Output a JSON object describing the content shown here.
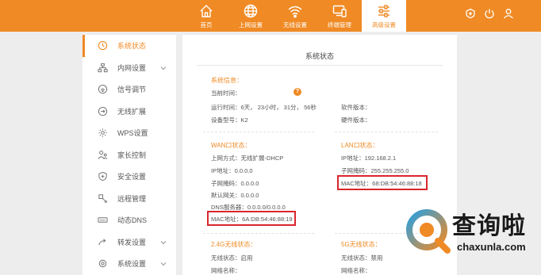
{
  "topnav": {
    "items": [
      {
        "label": "首页",
        "icon": "home-icon",
        "active": false
      },
      {
        "label": "上网设置",
        "icon": "globe-icon",
        "active": false
      },
      {
        "label": "无线设置",
        "icon": "wifi-icon",
        "active": false
      },
      {
        "label": "终端管理",
        "icon": "devices-icon",
        "active": false
      },
      {
        "label": "高级设置",
        "icon": "sliders-icon",
        "active": true
      }
    ],
    "right_icons": [
      "add-circle-icon",
      "power-icon",
      "user-icon"
    ]
  },
  "sidebar": {
    "items": [
      {
        "label": "系统状态",
        "icon": "clock-icon",
        "active": true,
        "expandable": false
      },
      {
        "label": "内网设置",
        "icon": "network-icon",
        "active": false,
        "expandable": true
      },
      {
        "label": "信号调节",
        "icon": "signal-icon",
        "active": false,
        "expandable": false
      },
      {
        "label": "无线扩展",
        "icon": "extend-icon",
        "active": false,
        "expandable": false
      },
      {
        "label": "WPS设置",
        "icon": "gear-icon",
        "active": false,
        "expandable": false
      },
      {
        "label": "家长控制",
        "icon": "parental-icon",
        "active": false,
        "expandable": false
      },
      {
        "label": "安全设置",
        "icon": "shield-icon",
        "active": false,
        "expandable": false
      },
      {
        "label": "远程管理",
        "icon": "remote-icon",
        "active": false,
        "expandable": false
      },
      {
        "label": "动态DNS",
        "icon": "dns-icon",
        "active": false,
        "expandable": false
      },
      {
        "label": "转发设置",
        "icon": "forward-icon",
        "active": false,
        "expandable": true
      },
      {
        "label": "系统设置",
        "icon": "settings-icon",
        "active": false,
        "expandable": true
      }
    ]
  },
  "main": {
    "title": "系统状态",
    "system": {
      "title": "系统信息：",
      "current_time_label": "当前时间：",
      "uptime_label": "运行时间：",
      "uptime_value": "6天， 23小时， 31分， 56秒",
      "model_label": "设备型号：",
      "model_value": "K2",
      "software_label": "软件版本：",
      "hardware_label": "硬件版本："
    },
    "wan": {
      "title": "WAN口状态：",
      "mode_label": "上网方式：",
      "mode_value": "无线扩展-DHCP",
      "ip_label": "IP地址：",
      "ip_value": "0.0.0.0",
      "mask_label": "子网掩码：",
      "mask_value": "0.0.0.0",
      "gateway_label": "默认网关：",
      "gateway_value": "0.0.0.0",
      "dns_label": "DNS服务器：",
      "dns_value": "0.0.0.0/0.0.0.0",
      "mac_label": "MAC地址：",
      "mac_value": "6A:DB:54:46:88:19"
    },
    "lan": {
      "title": "LAN口状态：",
      "ip_label": "IP地址：",
      "ip_value": "192.168.2.1",
      "mask_label": "子网掩码：",
      "mask_value": "255.255.255.0",
      "mac_label": "MAC地址：",
      "mac_value": "68:DB:54:46:88:18"
    },
    "wifi24": {
      "title": "2.4G无线状态：",
      "status_label": "无线状态：",
      "status_value": "启用",
      "ssid_label": "网络名称："
    },
    "wifi5": {
      "title": "5G无线状态：",
      "status_label": "无线状态：",
      "status_value": "禁用",
      "ssid_label": "网络名称："
    }
  },
  "watermark": {
    "text": "查询啦",
    "url": "chaxunla.com"
  },
  "colors": {
    "accent": "#f08a24",
    "highlight_box": "#d9262c"
  }
}
